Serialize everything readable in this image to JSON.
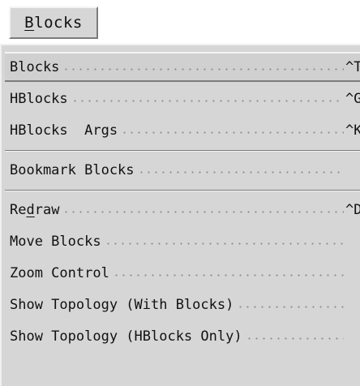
{
  "menubar": {
    "blocks_button": {
      "mnemonic": "B",
      "rest": "locks"
    }
  },
  "menu": {
    "items": [
      {
        "label": "Blocks",
        "shortcut": "^T"
      },
      {
        "label": "HBlocks",
        "shortcut": "^G"
      },
      {
        "label": "HBlocks  Args",
        "shortcut": "^K"
      },
      {
        "label": "Bookmark Blocks",
        "shortcut": ""
      },
      {
        "label_pre": "Re",
        "label_mnemonic": "d",
        "label_post": "raw",
        "shortcut": "^D"
      },
      {
        "label": "Move Blocks",
        "shortcut": ""
      },
      {
        "label": "Zoom Control",
        "shortcut": ""
      },
      {
        "label": "Show Topology (With Blocks)",
        "shortcut": ""
      },
      {
        "label": "Show Topology (HBlocks Only)",
        "shortcut": ""
      }
    ]
  }
}
